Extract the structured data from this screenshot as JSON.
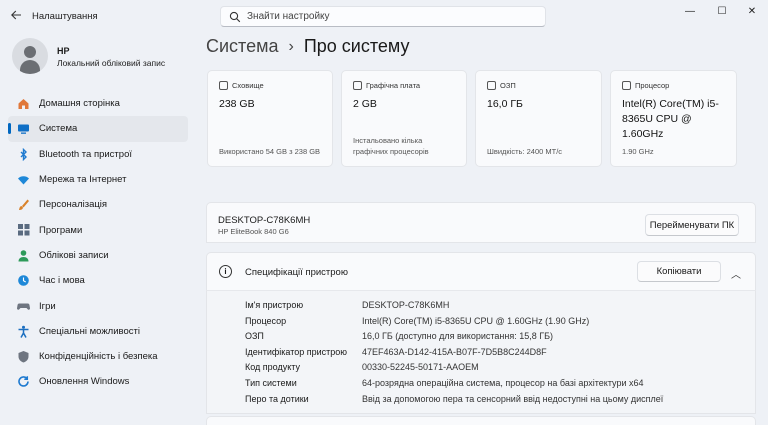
{
  "window": {
    "title": "Налаштування",
    "minimize_glyph": "—",
    "maximize_glyph": "☐",
    "close_glyph": "✕"
  },
  "search": {
    "placeholder": "Знайти настройку"
  },
  "user": {
    "name": "HP",
    "account_type": "Локальний обліковий запис"
  },
  "sidebar": {
    "items": [
      {
        "label": "Домашня сторінка",
        "icon": "home-icon",
        "color": "#e0783a"
      },
      {
        "label": "Система",
        "icon": "system-icon",
        "color": "#0f6fc6",
        "active": true
      },
      {
        "label": "Bluetooth та пристрої",
        "icon": "bluetooth-icon",
        "color": "#1e7ad0"
      },
      {
        "label": "Мережа та Інтернет",
        "icon": "network-icon",
        "color": "#1e88d8"
      },
      {
        "label": "Персоналізація",
        "icon": "brush-icon",
        "color": "#d9822b"
      },
      {
        "label": "Програми",
        "icon": "apps-icon",
        "color": "#5a6b80"
      },
      {
        "label": "Облікові записи",
        "icon": "accounts-icon",
        "color": "#2d9a5a"
      },
      {
        "label": "Час і мова",
        "icon": "time-language-icon",
        "color": "#1e88d8"
      },
      {
        "label": "Ігри",
        "icon": "gaming-icon",
        "color": "#6e7580"
      },
      {
        "label": "Спеціальні можливості",
        "icon": "accessibility-icon",
        "color": "#1c6fc0"
      },
      {
        "label": "Конфіденційність і безпека",
        "icon": "shield-icon",
        "color": "#6e7580"
      },
      {
        "label": "Оновлення Windows",
        "icon": "windows-update-icon",
        "color": "#1e7ad0"
      }
    ]
  },
  "breadcrumb": {
    "parent": "Система",
    "separator": "›",
    "current": "Про систему"
  },
  "spec_cards": [
    {
      "category": "Сховище",
      "value": "238 GB",
      "sub": "Використано 54 GB з 238 GB",
      "icon": "storage-icon"
    },
    {
      "category": "Графічна плата",
      "value": "2 GB",
      "sub": "Інстальовано кілька графічних процесорів",
      "icon": "gpu-icon"
    },
    {
      "category": "ОЗП",
      "value": "16,0 ГБ",
      "sub": "Швидкість: 2400 МТ/с",
      "icon": "ram-icon"
    },
    {
      "category": "Процесор",
      "value": "Intel(R) Core(TM) i5-8365U CPU @ 1.60GHz",
      "sub": "1.90 GHz",
      "icon": "cpu-icon"
    }
  ],
  "device": {
    "name": "DESKTOP-C78K6MH",
    "model": "HP EliteBook 840 G6",
    "rename_label": "Перейменувати ПК"
  },
  "specs": {
    "title": "Специфікації пристрою",
    "copy_label": "Копіювати",
    "collapse_glyph": "︿",
    "info_glyph": "i",
    "rows": [
      {
        "key": "Ім'я пристрою",
        "value": "DESKTOP-C78K6MH"
      },
      {
        "key": "Процесор",
        "value": "Intel(R) Core(TM) i5-8365U CPU @ 1.60GHz (1.90 GHz)"
      },
      {
        "key": "ОЗП",
        "value": "16,0 ГБ (доступно для використання: 15,8 ГБ)"
      },
      {
        "key": "Ідентифікатор пристрою",
        "value": "47EF463A-D142-415A-B07F-7D5B8C244D8F"
      },
      {
        "key": "Код продукту",
        "value": "00330-52245-50171-AAOEM"
      },
      {
        "key": "Тип системи",
        "value": "64-розрядна операційна система, процесор на базі архітектури x64"
      },
      {
        "key": "Перо та дотики",
        "value": "Ввід за допомогою пера та сенсорний ввід недоступні на цьому дисплеї"
      }
    ]
  },
  "colors": {
    "accent": "#0067c0",
    "background": "#eef1f6",
    "card": "#f9fafc"
  }
}
